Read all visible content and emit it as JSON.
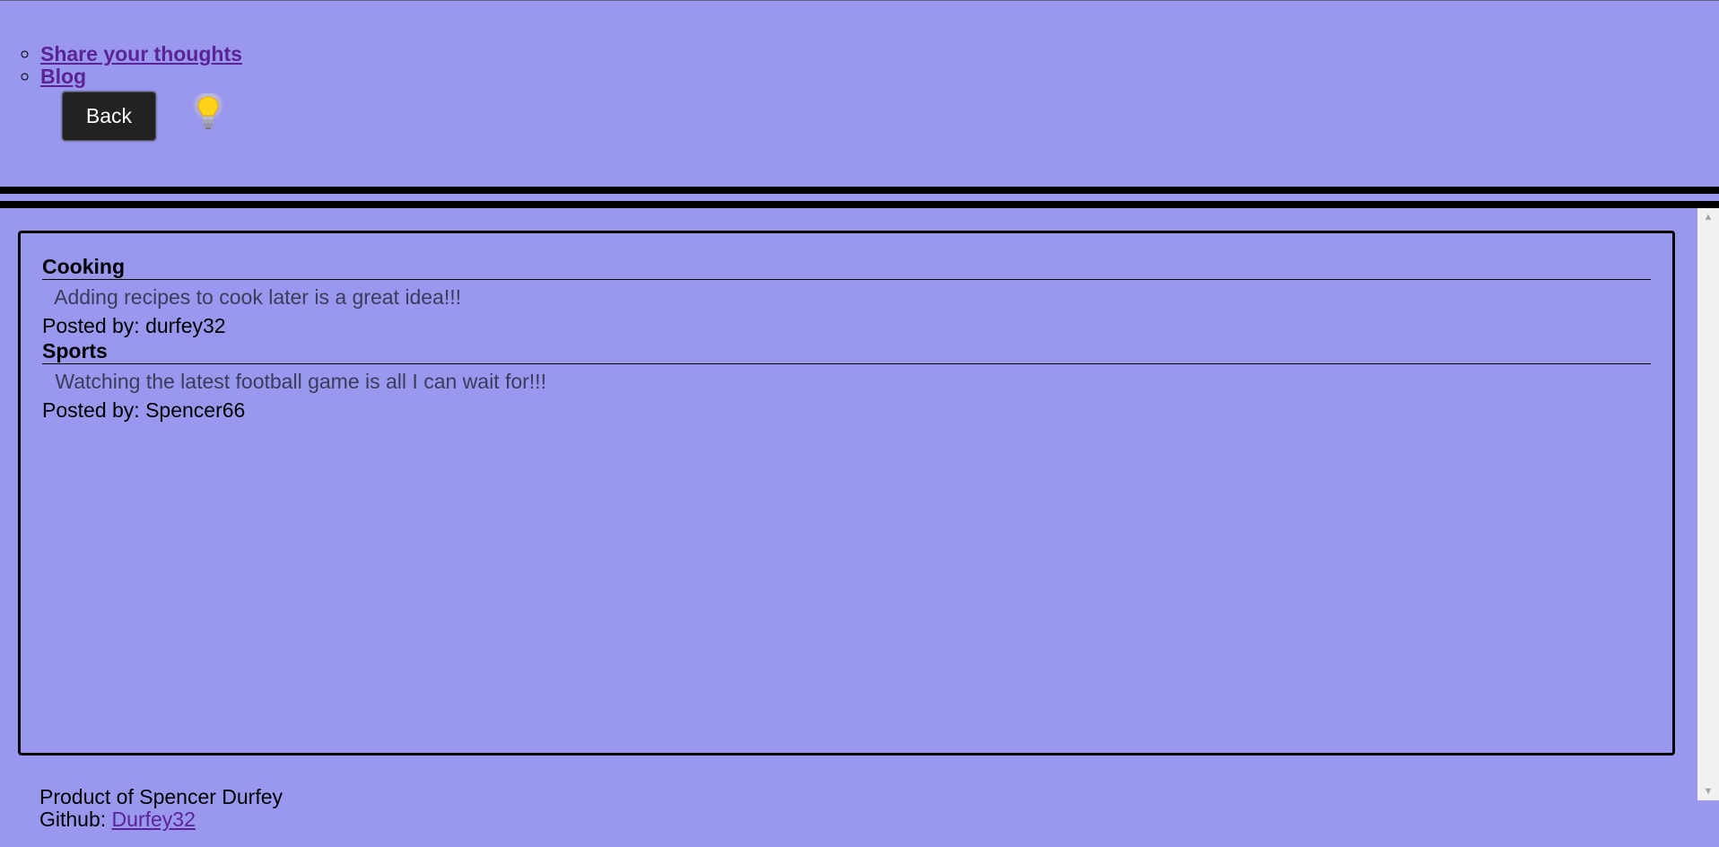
{
  "nav": {
    "items": [
      {
        "label": "Share your thoughts"
      },
      {
        "label": "Blog"
      }
    ],
    "back_label": "Back"
  },
  "posts": [
    {
      "title": "Cooking",
      "body": " Adding recipes to cook later is a great idea!!!",
      "author_line": "Posted by: durfey32"
    },
    {
      "title": "Sports",
      "body": " Watching the latest football game is all I can wait for!!!",
      "author_line": "Posted by: Spencer66"
    }
  ],
  "footer": {
    "credit": "Product of Spencer Durfey",
    "github_prefix": "Github: ",
    "github_link": "Durfey32"
  },
  "icons": {
    "theme_toggle": "lightbulb-icon"
  },
  "colors": {
    "background": "#9a98ee",
    "link": "#5b2397",
    "button": "#222222"
  }
}
